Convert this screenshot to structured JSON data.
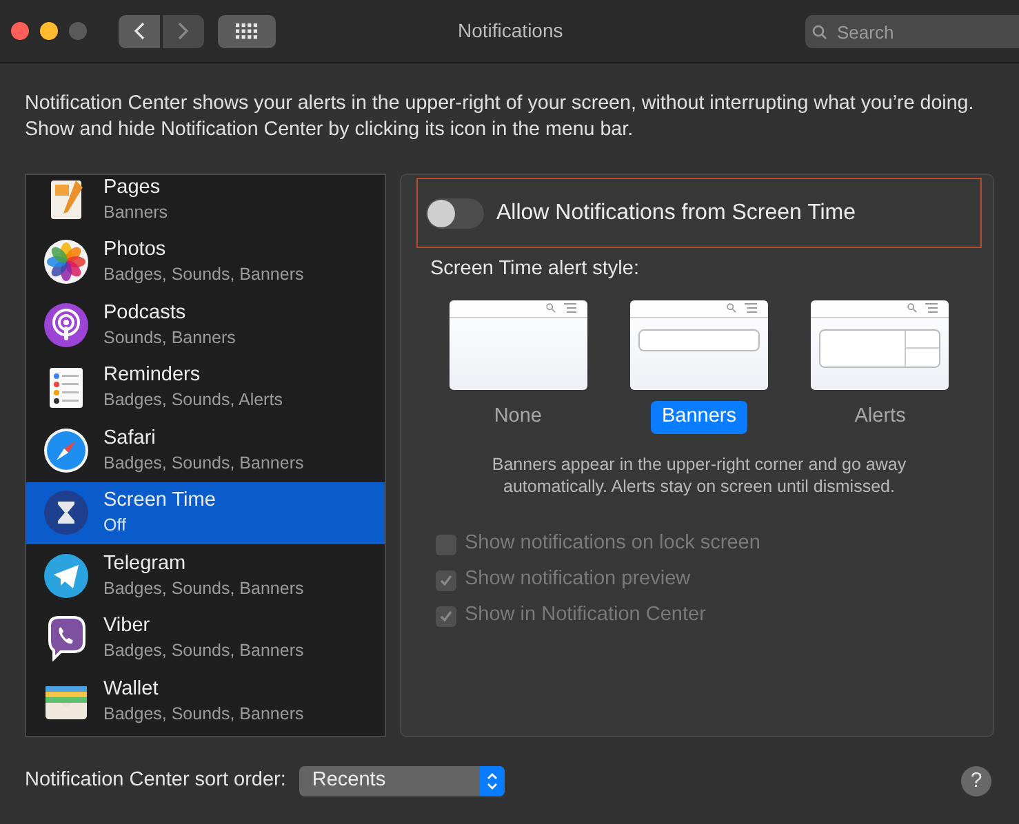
{
  "window": {
    "title": "Notifications",
    "search": {
      "placeholder": "Search"
    }
  },
  "intro": "Notification Center shows your alerts in the upper-right of your screen, without interrupting what you’re doing. Show and hide Notification Center by clicking its icon in the menu bar.",
  "apps": [
    {
      "kind": "pages",
      "name": "Pages",
      "detail": "Banners",
      "selected": false
    },
    {
      "kind": "photos",
      "name": "Photos",
      "detail": "Badges, Sounds, Banners",
      "selected": false
    },
    {
      "kind": "podcasts",
      "name": "Podcasts",
      "detail": "Sounds, Banners",
      "selected": false
    },
    {
      "kind": "reminders",
      "name": "Reminders",
      "detail": "Badges, Sounds, Alerts",
      "selected": false
    },
    {
      "kind": "safari",
      "name": "Safari",
      "detail": "Badges, Sounds, Banners",
      "selected": false
    },
    {
      "kind": "hourglass",
      "name": "Screen Time",
      "detail": "Off",
      "selected": true
    },
    {
      "kind": "telegram",
      "name": "Telegram",
      "detail": "Badges, Sounds, Banners",
      "selected": false
    },
    {
      "kind": "viber",
      "name": "Viber",
      "detail": "Badges, Sounds, Banners",
      "selected": false
    },
    {
      "kind": "wallet",
      "name": "Wallet",
      "detail": "Badges, Sounds, Banners",
      "selected": false
    }
  ],
  "detail": {
    "allow": {
      "label": "Allow Notifications from Screen Time",
      "on": false
    },
    "style_label": "Screen Time alert style:",
    "styles": [
      {
        "kind": "none",
        "label": "None",
        "selected": false
      },
      {
        "kind": "banner",
        "label": "Banners",
        "selected": true
      },
      {
        "kind": "alert",
        "label": "Alerts",
        "selected": false
      }
    ],
    "description": "Banners appear in the upper-right corner and go away automatically. Alerts stay on screen until dismissed.",
    "options": [
      {
        "label": "Show notifications on lock screen",
        "checked": false,
        "disabled": true
      },
      {
        "label": "Show notification preview",
        "checked": true,
        "disabled": true
      },
      {
        "label": "Show in Notification Center",
        "checked": true,
        "disabled": true
      }
    ]
  },
  "sort": {
    "label": "Notification Center sort order:",
    "value": "Recents"
  },
  "help": "?"
}
